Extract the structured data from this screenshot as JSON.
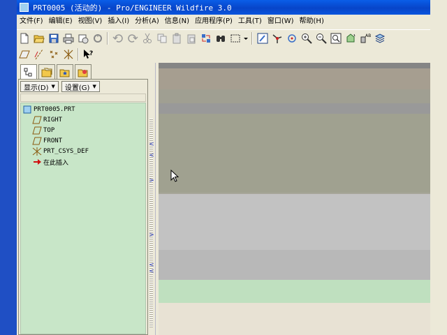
{
  "window": {
    "title": "PRT0005 (活动的) - Pro/ENGINEER Wildfire 3.0"
  },
  "menubar": {
    "items": [
      "文件(F)",
      "编辑(E)",
      "视图(V)",
      "插入(I)",
      "分析(A)",
      "信息(N)",
      "应用程序(P)",
      "工具(T)",
      "窗口(W)",
      "帮助(H)"
    ]
  },
  "toolbar": {
    "icons": [
      "new-file-icon",
      "open-folder-icon",
      "save-icon",
      "print-icon",
      "save-copy-icon",
      "email-icon",
      "undo-icon",
      "redo-icon",
      "cut-icon",
      "copy-icon",
      "paste-icon",
      "paste-special-icon",
      "regenerate-icon",
      "find-icon",
      "select-box-icon",
      "repaint-icon",
      "spin-center-icon",
      "orient-icon",
      "zoom-in-icon",
      "zoom-out-icon",
      "refit-icon",
      "reorient-icon",
      "saved-views-icon",
      "layers-icon"
    ],
    "datum_icons": [
      "datum-plane-icon",
      "datum-axis-icon",
      "datum-point-icon",
      "datum-csys-icon",
      "context-help-icon"
    ]
  },
  "navigator": {
    "tabs": [
      "model-tree-tab",
      "folder-browser-tab",
      "favorites-tab",
      "connections-tab"
    ],
    "show_label": "显示(D)",
    "settings_label": "设置(G)",
    "tree": [
      {
        "label": "PRT0005.PRT",
        "icon": "part-icon",
        "indent": 0
      },
      {
        "label": "RIGHT",
        "icon": "datum-plane-icon",
        "indent": 1
      },
      {
        "label": "TOP",
        "icon": "datum-plane-icon",
        "indent": 1
      },
      {
        "label": "FRONT",
        "icon": "datum-plane-icon",
        "indent": 1
      },
      {
        "label": "PRT_CSYS_DEF",
        "icon": "coordinate-system-icon",
        "indent": 1
      },
      {
        "label": "在此插入",
        "icon": "insert-here-arrow-icon",
        "indent": 1
      }
    ]
  },
  "colors": {
    "titlebar": "#0745c9",
    "tree_background": "#c8e6c8",
    "graphics_bands": [
      "#858585",
      "#a69e90",
      "#a09f92",
      "#999999",
      "#a69e90",
      "#a0a190",
      "#a7a699",
      "#c2c2c2",
      "#b8b8b8",
      "#bfe0bf",
      "#e8e2d4"
    ]
  }
}
